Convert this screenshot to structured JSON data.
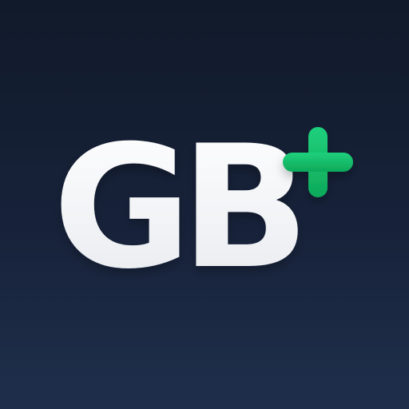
{
  "logo": {
    "text": "GB",
    "plus_icon": "plus-icon",
    "text_color": "#f3f5f8",
    "accent_color": "#13c06a",
    "background_top": "#111a2a",
    "background_bottom": "#1f2f4b"
  }
}
